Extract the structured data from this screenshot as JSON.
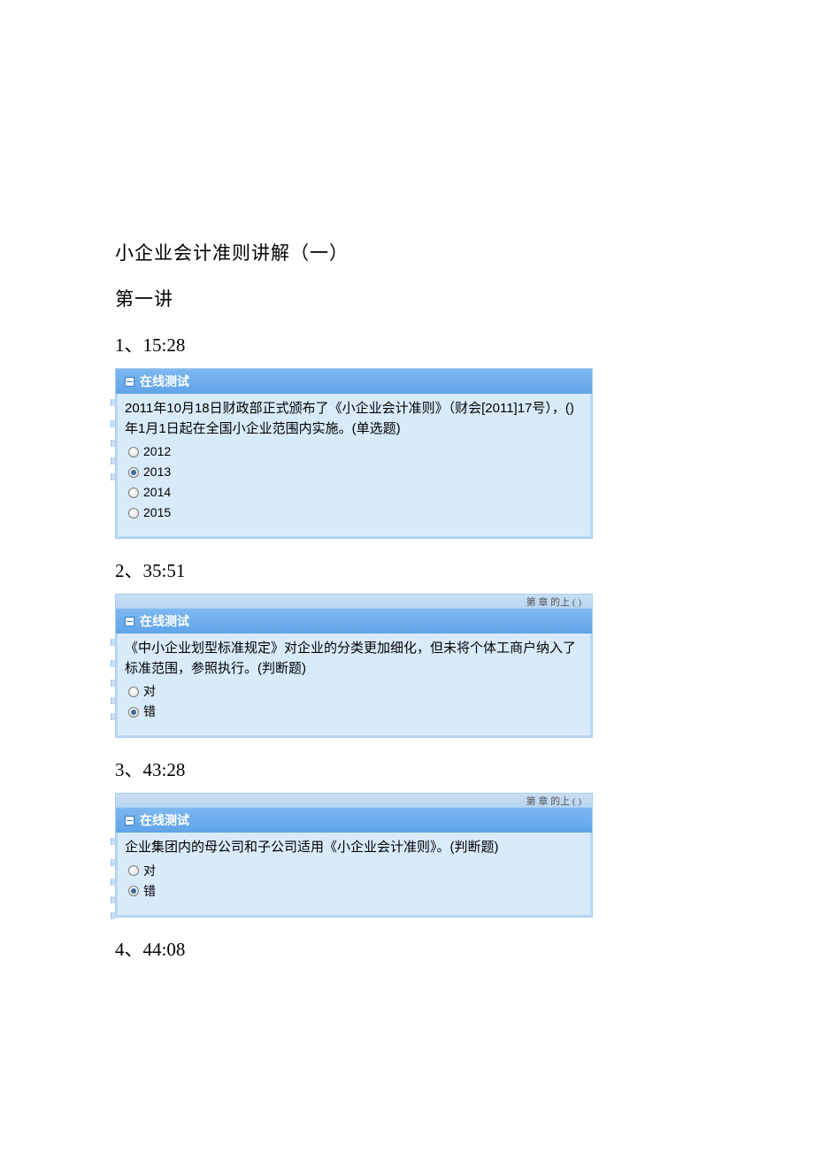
{
  "title": "小企业会计准则讲解（一）",
  "subtitle": "第一讲",
  "panel_title": "在线测试",
  "items": [
    {
      "label": "1、15:28",
      "question": "2011年10月18日财政部正式颁布了《小企业会计准则》（财会[2011]17号），()年1月1日起在全国小企业范围内实施。(单选题)",
      "options": [
        "2012",
        "2013",
        "2014",
        "2015"
      ],
      "selected_index": 1,
      "has_top_tab": false
    },
    {
      "label": "2、35:51",
      "question": "《中小企业划型标准规定》对企业的分类更加细化，但未将个体工商户纳入了标准范围，参照执行。(判断题)",
      "options": [
        "对",
        "错"
      ],
      "selected_index": 1,
      "has_top_tab": true
    },
    {
      "label": "3、43:28",
      "question": "企业集团内的母公司和子公司适用《小企业会计准则》。(判断题)",
      "options": [
        "对",
        "错"
      ],
      "selected_index": 1,
      "has_top_tab": true
    },
    {
      "label": "4、44:08",
      "question": "",
      "options": [],
      "selected_index": -1,
      "has_top_tab": false
    }
  ],
  "partial_tab_text": "第  章   的上  (  )"
}
